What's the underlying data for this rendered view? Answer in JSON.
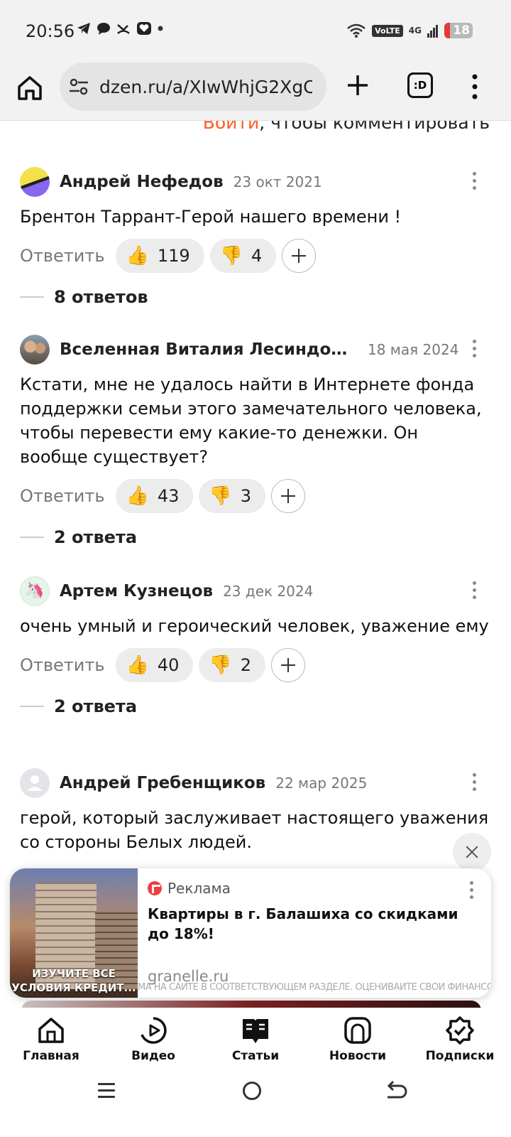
{
  "status_bar": {
    "time": "20:56",
    "volte": "VoLTE",
    "network": "4G",
    "battery": "18"
  },
  "browser": {
    "url": "dzen.ru/a/XIwWhjG2XgC",
    "tabs_label": ":D"
  },
  "login_prompt": {
    "link": "Войти",
    "text": ", чтобы комментировать"
  },
  "comments": [
    {
      "author": "Андрей Нефедов",
      "date": "23 окт 2021",
      "text": "Брентон Таррант-Герой нашего времени !",
      "reply_label": "Ответить",
      "likes": "119",
      "dislikes": "4",
      "replies": "8 ответов"
    },
    {
      "author": "Вселенная Виталия Лесиндорф...",
      "date": "18 мая 2024",
      "text": "Кстати, мне не удалось найти в Интернете фонда поддержки семьи этого замечательного человека, чтобы перевести ему какие-то денежки. Он вообще существует?",
      "reply_label": "Ответить",
      "likes": "43",
      "dislikes": "3",
      "replies": "2 ответа"
    },
    {
      "author": "Артем Кузнецов",
      "date": "23 дек 2024",
      "text": "очень умный и героический человек, уважение ему",
      "reply_label": "Ответить",
      "likes": "40",
      "dislikes": "2",
      "replies": "2 ответа"
    },
    {
      "author": "Андрей Гребенщиков",
      "date": "22 мар 2025",
      "text": "герой, который заслуживает настоящего уважения со стороны Белых людей."
    }
  ],
  "ad": {
    "tag": "Реклама",
    "title": "Квартиры в г. Балашиха со скидками до 18%!",
    "domain": "granelle.ru",
    "image_text": "ИЗУЧИТЕ ВСЕ УСЛОВИЯ КРЕДИТ...",
    "disclaimer": "МА НА САЙТЕ В СООТВЕТСТВУЮЩЕМ РАЗДЕЛЕ. ОЦЕНИВАЙТЕ СВОИ ФИНАНСОВЫЕ ВОЗМОЖНОСТИ И РИСКИ"
  },
  "bottom_nav": [
    {
      "label": "Главная"
    },
    {
      "label": "Видео"
    },
    {
      "label": "Статьи"
    },
    {
      "label": "Новости"
    },
    {
      "label": "Подписки"
    }
  ],
  "colors": {
    "accent": "#ff5a1f",
    "ad_logo": "#f03e3e"
  }
}
